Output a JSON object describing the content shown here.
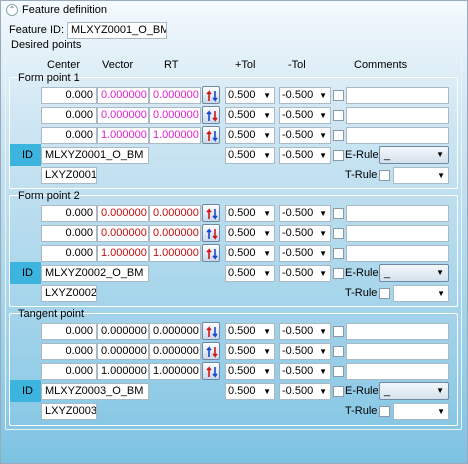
{
  "feature_definition": {
    "title": "Feature definition",
    "id_label": "Feature ID:",
    "id_value": "MLXYZ0001_O_BM"
  },
  "desired_points": {
    "title": "Desired points"
  },
  "columns": {
    "center": "Center",
    "vector": "Vector",
    "rt": "RT",
    "plus_tol": "+Tol",
    "minus_tol": "-Tol",
    "comments": "Comments"
  },
  "groups": [
    {
      "title": "Form point 1",
      "rows": [
        {
          "center": "0.000",
          "vector": "0.000000",
          "rt": "0.000000",
          "ptol": "0.500",
          "mtol": "-0.500"
        },
        {
          "center": "0.000",
          "vector": "0.000000",
          "rt": "0.000000",
          "ptol": "0.500",
          "mtol": "-0.500"
        },
        {
          "center": "0.000",
          "vector": "1.000000",
          "rt": "1.000000",
          "ptol": "0.500",
          "mtol": "-0.500"
        }
      ],
      "id_label": "ID",
      "id1": "MLXYZ0001_O_BM",
      "id2": "LXYZ0001",
      "ptol": "0.500",
      "mtol": "-0.500",
      "erule": "E-Rule",
      "erule_value": "_",
      "trule": "T-Rule"
    },
    {
      "title": "Form point 2",
      "rows": [
        {
          "center": "0.000",
          "vector": "0.000000",
          "rt": "0.000000",
          "ptol": "0.500",
          "mtol": "-0.500"
        },
        {
          "center": "0.000",
          "vector": "0.000000",
          "rt": "0.000000",
          "ptol": "0.500",
          "mtol": "-0.500"
        },
        {
          "center": "0.000",
          "vector": "1.000000",
          "rt": "1.000000",
          "ptol": "0.500",
          "mtol": "-0.500"
        }
      ],
      "id_label": "ID",
      "id1": "MLXYZ0002_O_BM",
      "id2": "LXYZ0002",
      "ptol": "0.500",
      "mtol": "-0.500",
      "erule": "E-Rule",
      "erule_value": "_",
      "trule": "T-Rule"
    },
    {
      "title": "Tangent point",
      "rows": [
        {
          "center": "0.000",
          "vector": "0.000000",
          "rt": "0.000000",
          "ptol": "0.500",
          "mtol": "-0.500"
        },
        {
          "center": "0.000",
          "vector": "0.000000",
          "rt": "0.000000",
          "ptol": "0.500",
          "mtol": "-0.500"
        },
        {
          "center": "0.000",
          "vector": "1.000000",
          "rt": "1.000000",
          "ptol": "0.500",
          "mtol": "-0.500"
        }
      ],
      "id_label": "ID",
      "id1": "MLXYZ0003_O_BM",
      "id2": "LXYZ0003",
      "ptol": "0.500",
      "mtol": "-0.500",
      "erule": "E-Rule",
      "erule_value": "_",
      "trule": "T-Rule"
    }
  ],
  "colors": {
    "form_point_vector": "#e020d0",
    "form_point_2_vector": "#c01010",
    "tangent_vector": "#000000",
    "highlight": "#3db4dd"
  },
  "icons": {
    "collapse": "chevron-up-icon",
    "flip": "flip-direction-icon"
  }
}
